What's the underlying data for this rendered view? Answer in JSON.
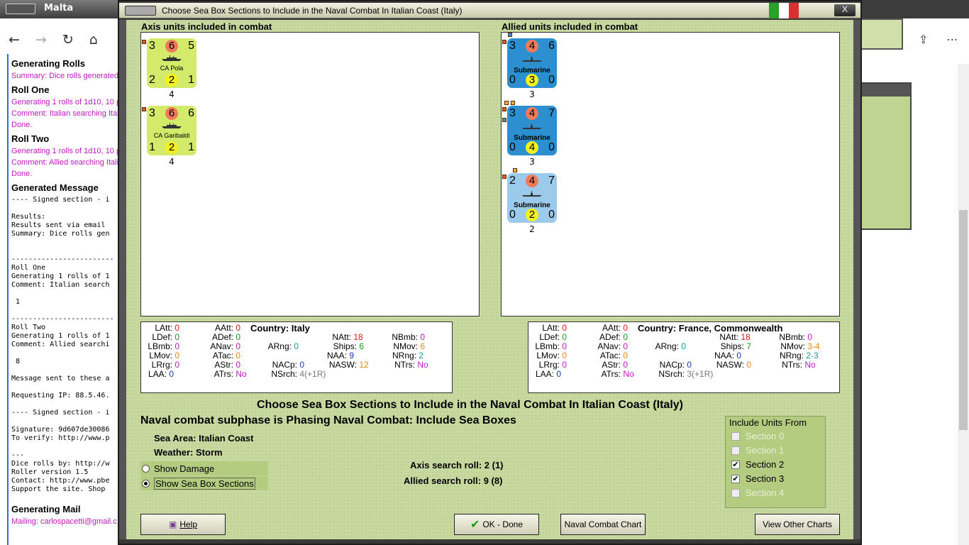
{
  "background_window": {
    "title": "Malta",
    "content": {
      "h1": "Generating Rolls",
      "summary": "Summary: Dice rolls generated",
      "roll_one": "Roll One",
      "gen1": "Generating 1 rolls of 1d10, 10 p",
      "comment1": "Comment: Italian searching Ital",
      "done1": "Done.",
      "roll_two": "Roll Two",
      "gen2": "Generating 1 rolls of 1d10, 10 p",
      "comment2": "Comment: Allied searching Itali",
      "done2": "Done.",
      "generated_message": "Generated Message",
      "mono": [
        "---- Signed section - i",
        "",
        "Results:",
        "Results sent via email",
        "Summary: Dice rolls gen",
        "",
        "",
        "------------------------",
        "Roll One",
        "Generating 1 rolls of 1",
        "Comment: Italian search",
        "",
        " 1",
        "",
        "------------------------",
        "Roll Two",
        "Generating 1 rolls of 1",
        "Comment: Allied searchi",
        "",
        " 8",
        "",
        "Message sent to these a",
        "",
        "Requesting IP: 88.5.46.",
        "",
        "---- Signed section - i",
        "",
        "Signature: 9d607de30086",
        "To verify: http://www.p",
        "",
        "---",
        "Dice rolls by: http://w",
        "Roller version 1.5",
        "Contact: http://www.pbe",
        "Support the site. Shop"
      ],
      "generating_mail": "Generating Mail",
      "mailing": "Mailing: carlospacetti@gmail.c"
    }
  },
  "dialog": {
    "title": "Choose Sea Box Sections to Include in the Naval Combat In Italian Coast (Italy)",
    "close_label": "X",
    "axis_label": "Axis units included in combat",
    "allied_label": "Allied units included in combat",
    "axis_units": [
      {
        "tl": "3",
        "tc": "6",
        "tr": "5",
        "name": "CA Pola",
        "bl": "2",
        "bc": "2",
        "br": "1",
        "below": "4",
        "color": "#d3ea6a"
      },
      {
        "tl": "3",
        "tc": "6",
        "tr": "6",
        "name": "CA Garibaldi",
        "bl": "1",
        "bc": "2",
        "br": "1",
        "below": "4",
        "color": "#d3ea6a"
      }
    ],
    "allied_units": [
      {
        "tl": "3",
        "tc": "4",
        "tr": "6",
        "name": "Submarine",
        "bl": "0",
        "bc": "3",
        "br": "0",
        "below": "3",
        "color": "#2c8fd0"
      },
      {
        "tl": "3",
        "tc": "4",
        "tr": "7",
        "name": "Submarine",
        "bl": "0",
        "bc": "4",
        "br": "0",
        "below": "3",
        "color": "#2c8fd0"
      },
      {
        "tl": "2",
        "tc": "4",
        "tr": "7",
        "name": "Submarine",
        "bl": "0",
        "bc": "2",
        "br": "0",
        "below": "2",
        "color": "#9ccaea"
      }
    ],
    "axis_stats": {
      "latt_k": "LAtt:",
      "latt": "0",
      "aatt_k": "AAtt:",
      "aatt": "0",
      "country_k": "Country:",
      "country": "Italy",
      "ldef_k": "LDef:",
      "ldef": "0",
      "adef_k": "ADef:",
      "adef": "0",
      "natt_k": "NAtt:",
      "natt": "18",
      "nbmb_k": "NBmb:",
      "nbmb": "0",
      "lbmb_k": "LBmb:",
      "lbmb": "0",
      "anav_k": "ANav:",
      "anav": "0",
      "arng_k": "ARng:",
      "arng": "0",
      "ships_k": "Ships:",
      "ships": "6",
      "nmov_k": "NMov:",
      "nmov": "6",
      "lmov_k": "LMov:",
      "lmov": "0",
      "atac_k": "ATac:",
      "atac": "0",
      "naa_k": "NAA:",
      "naa": "9",
      "nrng_k": "NRng:",
      "nrng": "2",
      "lrrg_k": "LRrg:",
      "lrrg": "0",
      "astr_k": "AStr:",
      "astr": "0",
      "nacp_k": "NACp:",
      "nacp": "0",
      "nasw_k": "NASW:",
      "nasw": "12",
      "ntrs_k": "NTrs:",
      "ntrs": "No",
      "laa_k": "LAA:",
      "laa": "0",
      "atrs_k": "ATrs:",
      "atrs": "No",
      "nsrch_k": "NSrch:",
      "nsrch": "4(+1R)"
    },
    "allied_stats": {
      "latt_k": "LAtt:",
      "latt": "0",
      "aatt_k": "AAtt:",
      "aatt": "0",
      "country_k": "Country:",
      "country": "France, Commonwealth",
      "ldef_k": "LDef:",
      "ldef": "0",
      "adef_k": "ADef:",
      "adef": "0",
      "natt_k": "NAtt:",
      "natt": "18",
      "nbmb_k": "NBmb:",
      "nbmb": "0",
      "lbmb_k": "LBmb:",
      "lbmb": "0",
      "anav_k": "ANav:",
      "anav": "0",
      "arng_k": "ARng:",
      "arng": "0",
      "ships_k": "Ships:",
      "ships": "7",
      "nmov_k": "NMov:",
      "nmov": "3-4",
      "lmov_k": "LMov:",
      "lmov": "0",
      "atac_k": "ATac:",
      "atac": "0",
      "naa_k": "NAA:",
      "naa": "0",
      "nrng_k": "NRng:",
      "nrng": "2-3",
      "lrrg_k": "LRrg:",
      "lrrg": "0",
      "astr_k": "AStr:",
      "astr": "0",
      "nacp_k": "NACp:",
      "nacp": "0",
      "nasw_k": "NASW:",
      "nasw": "0",
      "ntrs_k": "NTrs:",
      "ntrs": "No",
      "laa_k": "LAA:",
      "laa": "0",
      "atrs_k": "ATrs:",
      "atrs": "No",
      "nsrch_k": "NSrch:",
      "nsrch": "3(+1R)"
    },
    "main_heading": "Choose Sea Box Sections to Include in the Naval Combat In Italian Coast (Italy)",
    "subphase": "Naval combat subphase is Phasing Naval Combat: Include Sea Boxes",
    "sea_area_label": "Sea Area:",
    "sea_area": "Italian Coast",
    "weather_label": "Weather:",
    "weather": "Storm",
    "show_damage": "Show Damage",
    "show_sea_box": "Show Sea Box Sections",
    "axis_search_label": "Axis search roll:",
    "axis_search": "2 (1)",
    "allied_search_label": "Allied search roll:",
    "allied_search": "9 (8)",
    "include_title": "Include Units From",
    "sections": [
      {
        "label": "Section 0",
        "checked": false,
        "enabled": false
      },
      {
        "label": "Section 1",
        "checked": false,
        "enabled": false
      },
      {
        "label": "Section 2",
        "checked": true,
        "enabled": true
      },
      {
        "label": "Section 3",
        "checked": true,
        "enabled": true
      },
      {
        "label": "Section 4",
        "checked": false,
        "enabled": false
      }
    ],
    "buttons": {
      "help": "Help",
      "ok": "OK - Done",
      "naval_chart": "Naval Combat Chart",
      "other_charts": "View Other Charts"
    }
  },
  "colors": {
    "dialog_bg": "#c8d9a0",
    "axis_counter": "#d3ea6a",
    "allied_counter": "#2c8fd0",
    "allied_counter_light": "#9ccaea"
  }
}
